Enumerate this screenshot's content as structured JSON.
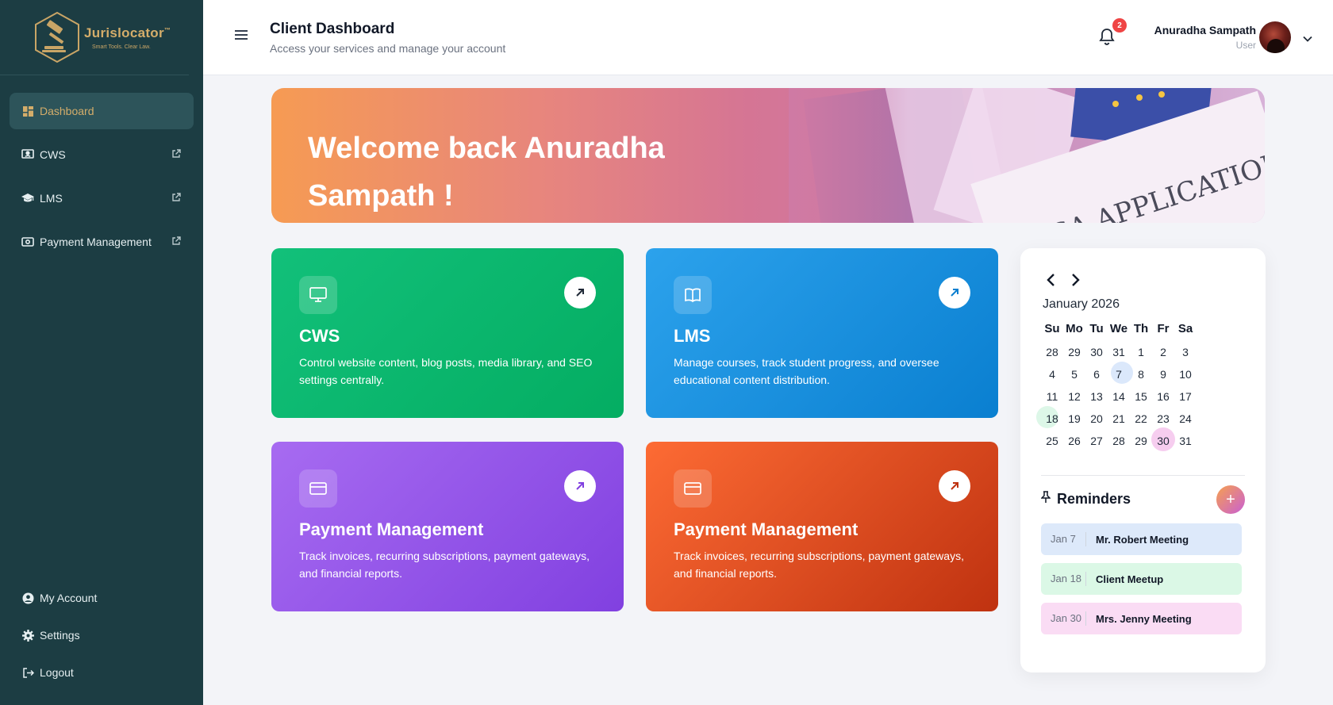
{
  "brand": {
    "name": "Jurislocator",
    "trademark": "™",
    "tagline": "Smart Tools. Clear Law."
  },
  "sidebar": {
    "items": [
      {
        "label": "Dashboard",
        "icon": "grid-icon",
        "active": true
      },
      {
        "label": "CWS",
        "icon": "monitor-icon",
        "external": true
      },
      {
        "label": "LMS",
        "icon": "graduation-cap-icon",
        "external": true
      },
      {
        "label": "Payment Management",
        "icon": "money-icon",
        "external": true
      }
    ],
    "bottom": [
      {
        "label": "My Account",
        "icon": "user-circle-icon"
      },
      {
        "label": "Settings",
        "icon": "gear-icon"
      },
      {
        "label": "Logout",
        "icon": "logout-icon"
      }
    ]
  },
  "header": {
    "title": "Client Dashboard",
    "subtitle": "Access your services and manage your account",
    "notifications": "2",
    "user_name": "Anuradha Sampath",
    "user_role": "User"
  },
  "banner": {
    "welcome": "Welcome back Anuradha Sampath !"
  },
  "cards": [
    {
      "title": "CWS",
      "desc": "Control website content, blog posts, media library, and SEO settings centrally.",
      "icon": "monitor-icon",
      "color": "#04ad62"
    },
    {
      "title": "LMS",
      "desc": "Manage courses, track student progress, and oversee educational content distribution.",
      "icon": "book-icon",
      "color": "#0a7fd0"
    },
    {
      "title": "Payment Management",
      "desc": "Track invoices, recurring subscriptions, payment gateways, and financial reports.",
      "icon": "credit-card-icon",
      "color": "#8140e0"
    },
    {
      "title": "Payment Management",
      "desc": "Track invoices, recurring subscriptions, payment gateways, and financial reports.",
      "icon": "credit-card-icon",
      "color": "#bf3210"
    }
  ],
  "calendar": {
    "month": "January 2026",
    "day_names": [
      "Su",
      "Mo",
      "Tu",
      "We",
      "Th",
      "Fr",
      "Sa"
    ],
    "days": [
      "28",
      "29",
      "30",
      "31",
      "1",
      "2",
      "3",
      "4",
      "5",
      "6",
      "7",
      "8",
      "9",
      "10",
      "11",
      "12",
      "13",
      "14",
      "15",
      "16",
      "17",
      "18",
      "19",
      "20",
      "21",
      "22",
      "23",
      "24",
      "25",
      "26",
      "27",
      "28",
      "29",
      "30",
      "31"
    ],
    "today_index": 10,
    "marked": [
      {
        "index": 21,
        "color": "green"
      },
      {
        "index": 33,
        "color": "pink"
      }
    ]
  },
  "reminders": {
    "title": "Reminders",
    "add_label": "+",
    "items": [
      {
        "date": "Jan 7",
        "text": "Mr. Robert Meeting"
      },
      {
        "date": "Jan 18",
        "text": "Client Meetup"
      },
      {
        "date": "Jan 30",
        "text": "Mrs. Jenny Meeting"
      }
    ]
  },
  "colors": {
    "sidebar": "#1c3d43",
    "accent_gold": "#d4ad6a",
    "badge": "#ef4444"
  }
}
